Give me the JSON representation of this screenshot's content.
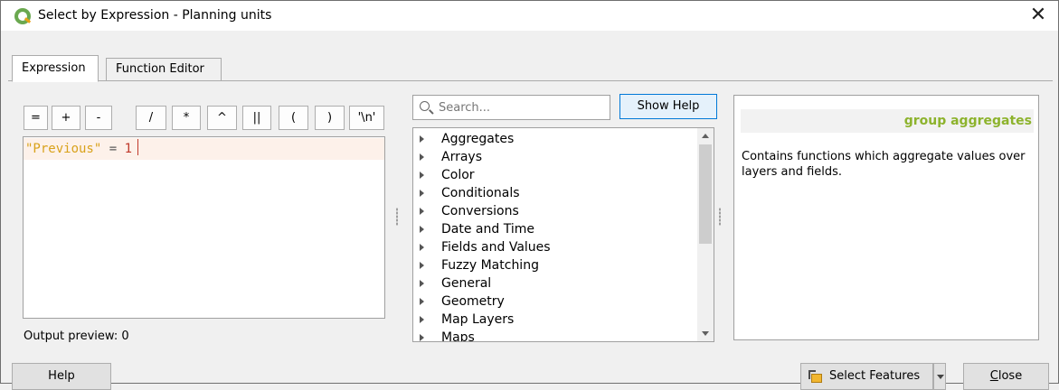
{
  "window": {
    "title": "Select by Expression - Planning units",
    "close_glyph": "✕"
  },
  "tabs": [
    {
      "label": "Expression",
      "active": true
    },
    {
      "label": "Function Editor",
      "active": false
    }
  ],
  "operators": [
    "=",
    "+",
    "-",
    "/",
    "*",
    "^",
    "||",
    "(",
    ")",
    "'\\n'"
  ],
  "editor": {
    "field": "\"Previous\"",
    "operator": "=",
    "value": "1"
  },
  "output_preview": "Output preview:  0",
  "search": {
    "placeholder": "Search...",
    "value": ""
  },
  "show_help_label": "Show Help",
  "function_groups": [
    "Aggregates",
    "Arrays",
    "Color",
    "Conditionals",
    "Conversions",
    "Date and Time",
    "Fields and Values",
    "Fuzzy Matching",
    "General",
    "Geometry",
    "Map Layers",
    "Maps"
  ],
  "help": {
    "title": "group aggregates",
    "body": "Contains functions which aggregate values over layers and fields."
  },
  "buttons": {
    "help": "Help",
    "select_features": "Select Features",
    "close": "Close"
  },
  "colors": {
    "help_title": "#8db32d",
    "field_token": "#d9a21b",
    "number_token": "#c0392b",
    "primary_border": "#0078d7"
  }
}
